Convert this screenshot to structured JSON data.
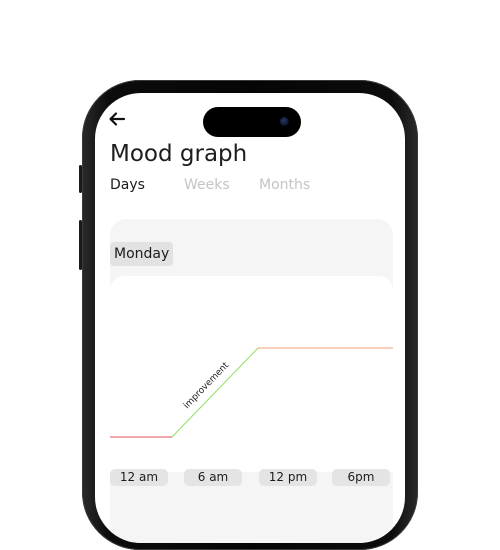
{
  "header": {
    "title": "Mood graph"
  },
  "tabs": [
    {
      "label": "Days",
      "active": true
    },
    {
      "label": "Weeks",
      "active": false
    },
    {
      "label": "Months",
      "active": false
    }
  ],
  "card": {
    "day_label": "Monday"
  },
  "chart_data": {
    "type": "line",
    "x": [
      "12 am",
      "6 am",
      "12 pm",
      "6pm"
    ],
    "annotation": "improvement",
    "segment_colors": [
      "#e05050",
      "#8fe060",
      "#f0a070"
    ]
  },
  "icons": {
    "back": "arrow-left-icon"
  }
}
